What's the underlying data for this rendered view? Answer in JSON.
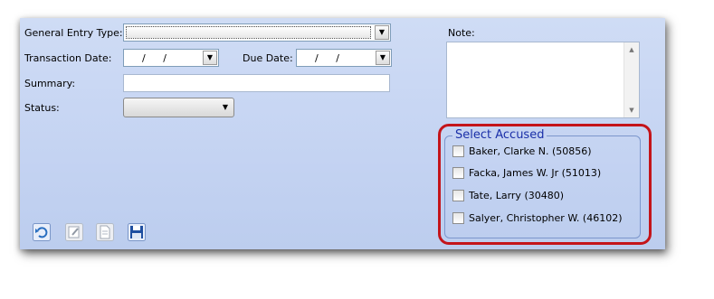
{
  "form": {
    "general_entry_type_label": "General Entry Type:",
    "general_entry_type_value": "",
    "transaction_date_label": "Transaction Date:",
    "transaction_date_value": "/ /",
    "due_date_label": "Due Date:",
    "due_date_value": "/ /",
    "summary_label": "Summary:",
    "summary_value": "",
    "status_label": "Status:",
    "status_value": ""
  },
  "note": {
    "label": "Note:",
    "value": ""
  },
  "accused": {
    "title": "Select Accused",
    "items": [
      {
        "label": "Baker, Clarke N. (50856)",
        "checked": false
      },
      {
        "label": "Facka, James W. Jr (51013)",
        "checked": false
      },
      {
        "label": "Tate, Larry (30480)",
        "checked": false
      },
      {
        "label": "Salyer, Christopher W. (46102)",
        "checked": false
      }
    ]
  },
  "toolbar": {
    "icons": [
      "undo-icon",
      "edit-icon",
      "document-icon",
      "save-icon"
    ]
  },
  "colors": {
    "panel_bg": "#c6d4f2",
    "highlight": "#c4141a",
    "group_title": "#1a2fa8"
  }
}
